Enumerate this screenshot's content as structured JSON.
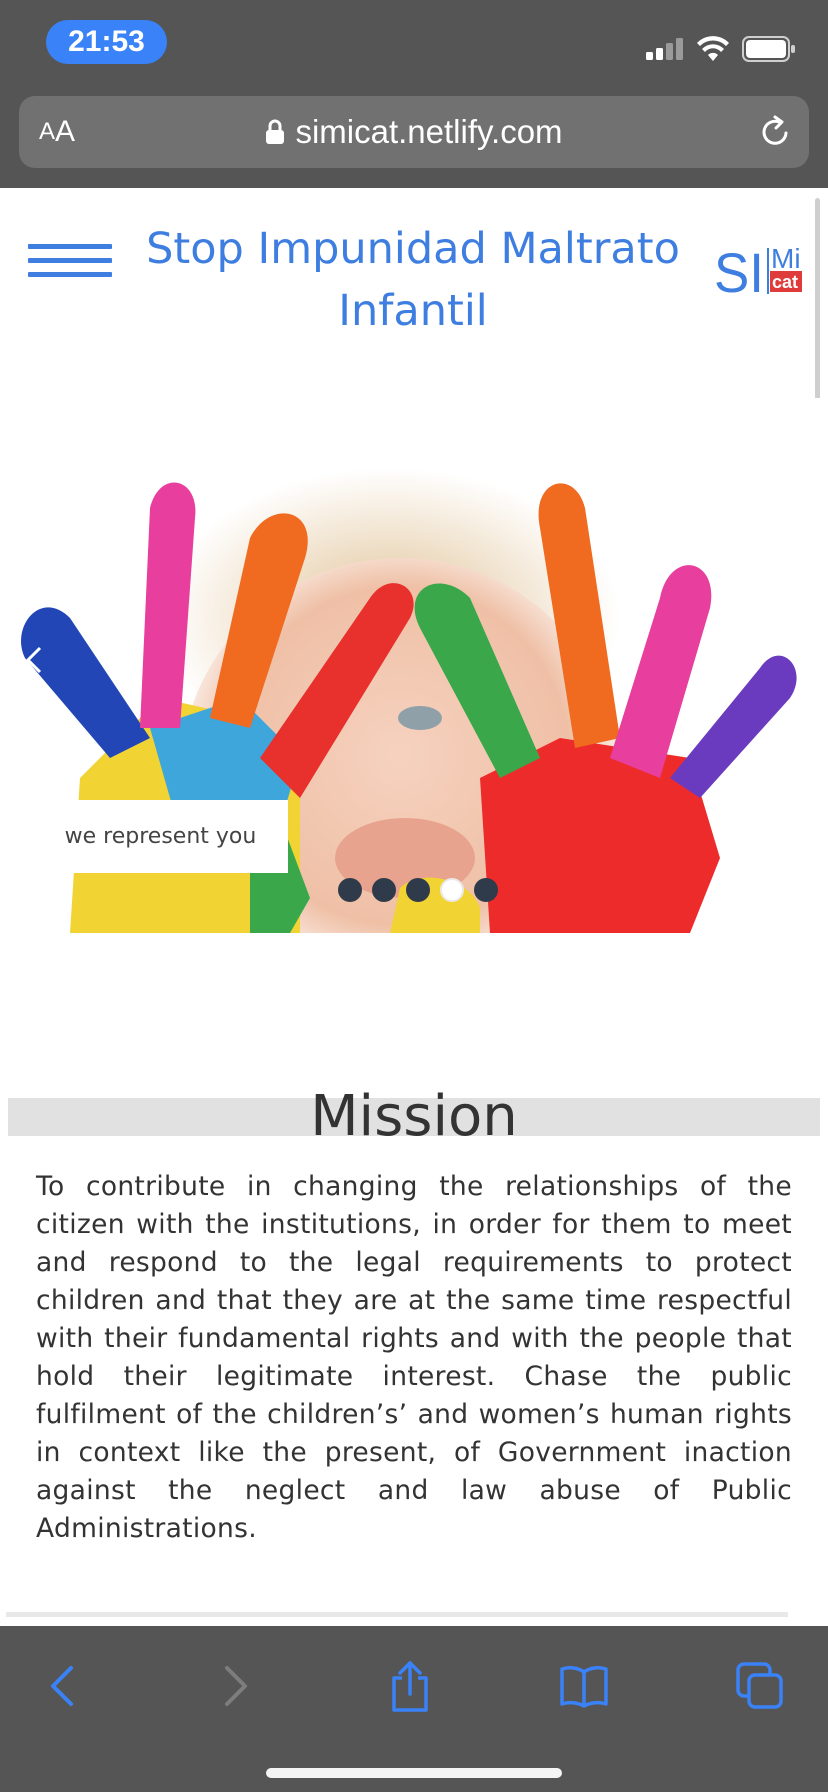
{
  "status_bar": {
    "time": "21:53",
    "icons": [
      "cellular-signal-icon",
      "wifi-icon",
      "battery-icon"
    ]
  },
  "browser": {
    "aa_label_small": "A",
    "aa_label_large": "A",
    "url": "simicat.netlify.com",
    "lock_icon": "lock-icon",
    "reload_icon": "reload-icon"
  },
  "header": {
    "menu_icon": "hamburger-menu-icon",
    "title": "Stop Impunidad Maltrato Infantil",
    "logo": {
      "letters_left": "SI",
      "letters_top": "Mi",
      "letters_box": "cat",
      "blue": "#3e7ee0",
      "red": "#e03b3b"
    }
  },
  "hero": {
    "caption": "we represent you",
    "slide_count": 5,
    "active_slide": 4,
    "prev_icon": "chevron-left-icon"
  },
  "mission": {
    "title": "Mission",
    "body": "To contribute in changing the relationships of the citizen with the institutions, in order for them to meet and respond to the legal requirements to protect children and that they are at the same time respectful with their fundamental rights and with the people that hold their legitimate interest. Chase the public fulfilment of the children’s’ and women’s human rights in context like the present, of Government inaction against the neglect and law abuse of Public Administrations."
  },
  "toolbar": {
    "items": [
      "back-icon",
      "forward-icon",
      "share-icon",
      "bookmarks-icon",
      "tabs-icon"
    ],
    "accent": "#3a82f7"
  }
}
